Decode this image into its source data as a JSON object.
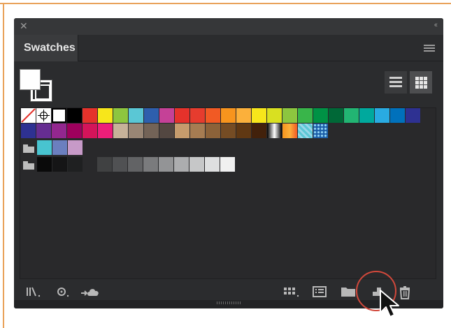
{
  "panel": {
    "close_glyph": "✕",
    "collapse_glyph": "‹‹",
    "tab_label": "Swatches"
  },
  "colors": {
    "frame_accent": "#e9a25a",
    "highlight_circle": "#d2483b",
    "panel_bg": "#2b2c2e"
  },
  "rows": {
    "row1": [
      "none",
      "registration",
      "white",
      "#000000",
      "#e5322b",
      "#f7e61b",
      "#8dc63f",
      "#5ac7d5",
      "#2e5fad",
      "#c54197",
      "#e5322b",
      "#e63c2e",
      "#f15a24",
      "#f7941d",
      "#fbb03b",
      "#f7e61b",
      "#d9e021",
      "#8cc63f",
      "#39b54a",
      "#009245",
      "#006837",
      "#22b573",
      "#00a99d",
      "#29abe2",
      "#0071bc",
      "#2e3192"
    ],
    "row2": [
      "#2e3192",
      "#662d91",
      "#93278f",
      "#9e005d",
      "#d4145a",
      "#ed1e79",
      "#c7b299",
      "#998675",
      "#736357",
      "#534741",
      "#c69c6d",
      "#a67c52",
      "#8c6239",
      "#754c24",
      "#603813",
      "#42210b",
      "gradient-bw",
      "gradient-orange",
      "pattern-blue",
      "pattern-stars"
    ],
    "row3_group": [
      "#48c4d0",
      "#6b7fbf",
      "#c79ac8"
    ],
    "row4_group": [
      "#0a0a0a",
      "#151516",
      "#1f2021",
      "#404142",
      "#505153",
      "#626365",
      "#7a7b7d",
      "#939496",
      "#acadaf",
      "#c6c7c8",
      "#dedfe0",
      "#f0f0f0"
    ]
  },
  "toolbar": {
    "icons": [
      "swatch-libraries-icon",
      "show-kinds-icon",
      "cc-libraries-icon",
      "swatch-options-grid-icon",
      "swatch-options-list-icon",
      "new-group-folder-icon",
      "new-swatch-icon",
      "delete-swatch-icon"
    ]
  }
}
